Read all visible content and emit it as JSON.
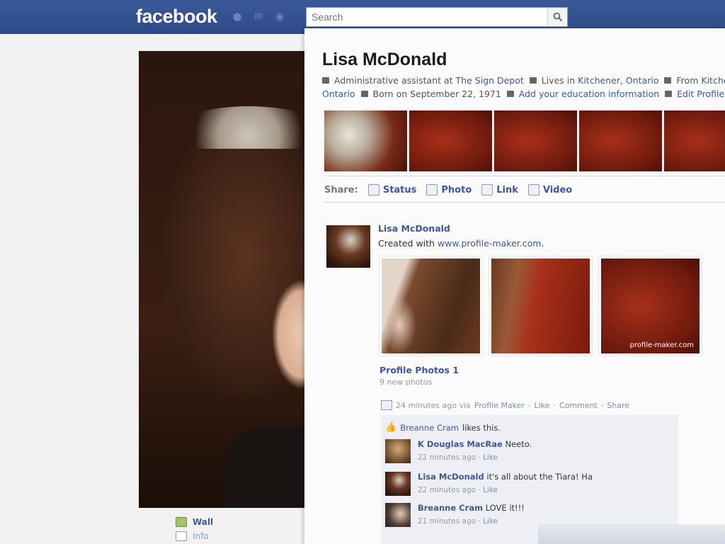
{
  "topbar": {
    "logo": "facebook",
    "search_placeholder": "Search",
    "accent": "#3b5998"
  },
  "profile": {
    "name": "Lisa McDonald",
    "work_prefix": "Administrative assistant at",
    "employer": "The Sign Depot",
    "lives_prefix": "Lives in",
    "lives_in": "Kitchener, Ontario",
    "from_prefix": "From",
    "from_city": "Kitchener,",
    "from_region": "Ontario",
    "born": "Born on September 22, 1971",
    "education_link": "Add your education information",
    "edit_link": "Edit Profile"
  },
  "share": {
    "label": "Share:",
    "items": [
      "Status",
      "Photo",
      "Link",
      "Video"
    ]
  },
  "post": {
    "author": "Lisa McDonald",
    "text_prefix": "Created with",
    "text_link": "www.profile-maker.com",
    "text_suffix": ".",
    "watermark": "profile-maker.com",
    "album_title": "Profile Photos 1",
    "album_count": "9 new photos",
    "meta_time": "24 minutes ago via",
    "meta_app": "Profile Maker",
    "actions": [
      "Like",
      "Comment",
      "Share"
    ],
    "likes_name": "Breanne Cram",
    "likes_suffix": "likes this."
  },
  "comments": [
    {
      "author": "K Douglas MacRae",
      "text": "Neeto.",
      "time": "22 minutes ago",
      "action": "Like"
    },
    {
      "author": "Lisa McDonald",
      "text": "it's all about the Tiara! Ha",
      "time": "22 minutes ago",
      "action": "Like"
    },
    {
      "author": "Breanne Cram",
      "text": "LOVE it!!!",
      "time": "21 minutes ago",
      "action": "Like"
    }
  ],
  "left_nav": {
    "wall": "Wall",
    "info": "Info"
  }
}
